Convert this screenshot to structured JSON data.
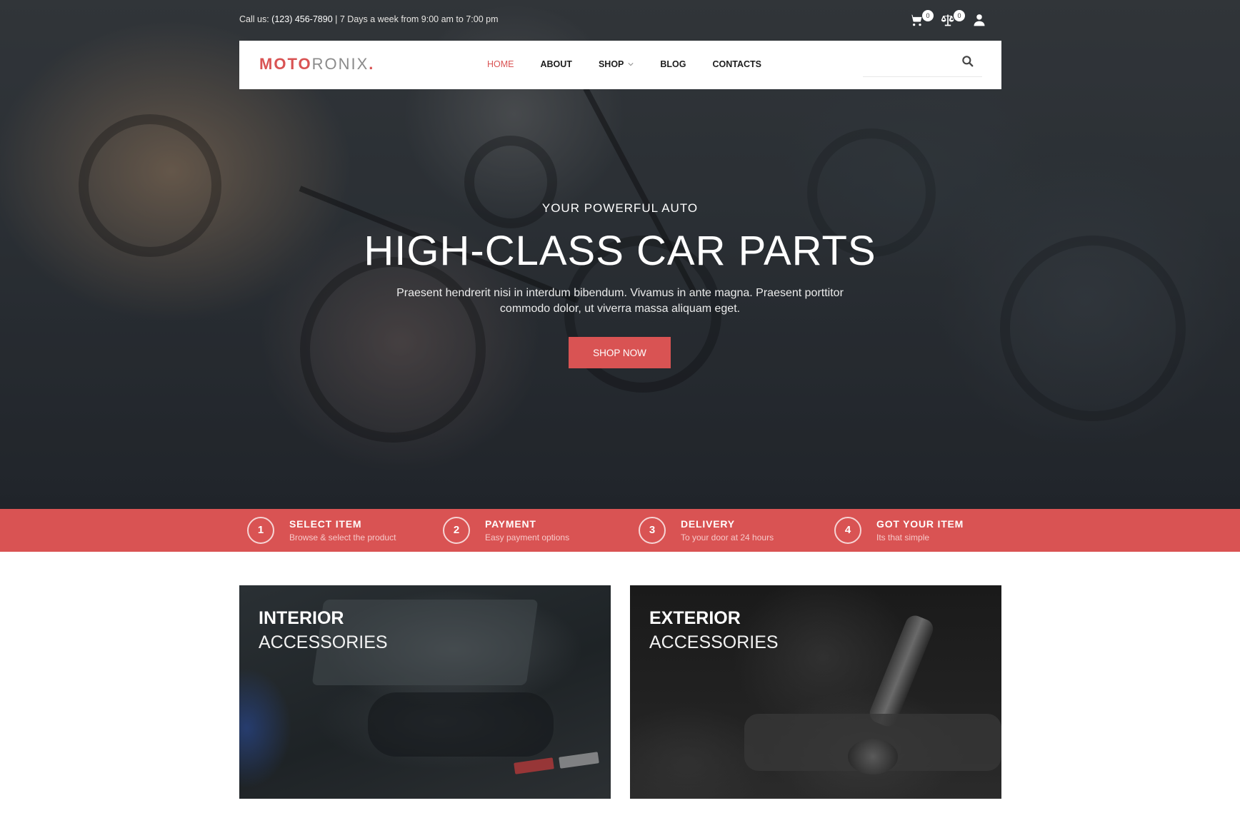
{
  "topbar": {
    "call_label": "Call us:",
    "phone": "(123) 456-7890",
    "hours": "| 7 Days a week from 9:00 am to 7:00 pm",
    "cart_count": "0",
    "compare_count": "0",
    "icons": [
      "cart-icon",
      "compare-scale-icon",
      "user-icon"
    ]
  },
  "brand": {
    "logo_bold": "MOTO",
    "logo_light": "RONIX",
    "logo_dot": ".",
    "accent_color": "#d95353"
  },
  "nav": {
    "items": [
      {
        "label": "HOME",
        "active": true
      },
      {
        "label": "ABOUT",
        "active": false
      },
      {
        "label": "SHOP",
        "active": false,
        "has_dropdown": true
      },
      {
        "label": "BLOG",
        "active": false
      },
      {
        "label": "CONTACTS",
        "active": false
      }
    ],
    "search": {
      "value": "",
      "placeholder": ""
    }
  },
  "hero": {
    "eyebrow": "YOUR POWERFUL AUTO",
    "title": "HIGH-CLASS CAR PARTS",
    "description": "Praesent hendrerit nisi in interdum bibendum. Vivamus in ante magna. Praesent porttitor commodo dolor, ut viverra massa aliquam eget.",
    "cta_label": "SHOP NOW"
  },
  "steps": [
    {
      "number": "1",
      "title": "SELECT ITEM",
      "subtitle": "Browse & select the product"
    },
    {
      "number": "2",
      "title": "PAYMENT",
      "subtitle": "Easy payment options"
    },
    {
      "number": "3",
      "title": "DELIVERY",
      "subtitle": "To your door at 24 hours"
    },
    {
      "number": "4",
      "title": "GOT YOUR ITEM",
      "subtitle": "Its that simple"
    }
  ],
  "categories": [
    {
      "title": "INTERIOR",
      "subtitle": "ACCESSORIES"
    },
    {
      "title": "EXTERIOR",
      "subtitle": "ACCESSORIES"
    }
  ]
}
